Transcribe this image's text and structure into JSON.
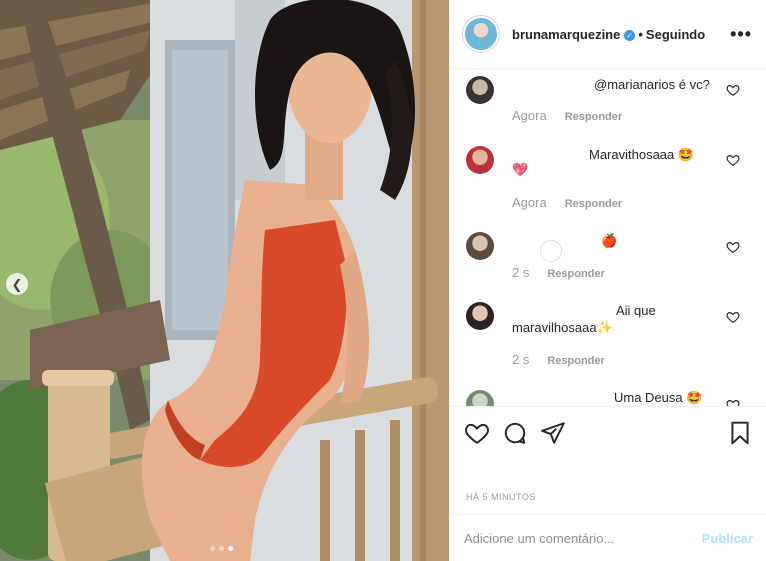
{
  "post": {
    "username": "brunamarquezine",
    "verified_icon": "verified-badge-icon",
    "separator": "•",
    "follow_status": "Seguindo",
    "more_label": "•••"
  },
  "carousel": {
    "total_slides": 3,
    "current_slide": 3
  },
  "comments": [
    {
      "text": "@marianarios é vc?",
      "time": "Agora",
      "reply": "Responder"
    },
    {
      "text": "Maravithosaaa 🤩",
      "extra": "💖",
      "time": "Agora",
      "reply": "Responder"
    },
    {
      "text": "🍎",
      "time": "2 s",
      "reply": "Responder"
    },
    {
      "text": "Aii que",
      "text2": "maravilhosaaa✨",
      "time": "2 s",
      "reply": "Responder"
    },
    {
      "text": "Uma Deusa 🤩"
    }
  ],
  "actions": {
    "like_icon": "heart-icon",
    "comment_icon": "comment-bubble-icon",
    "share_icon": "paper-plane-icon",
    "save_icon": "bookmark-icon"
  },
  "timestamp": "HÁ 5 MINUTOS",
  "add_comment": {
    "placeholder": "Adicione um comentário...",
    "publish_label": "Publicar"
  },
  "colors": {
    "link_blue": "#3897f0",
    "publish_disabled": "#b2dffc",
    "meta_gray": "#999999",
    "swimsuit": "#d84a2a"
  }
}
